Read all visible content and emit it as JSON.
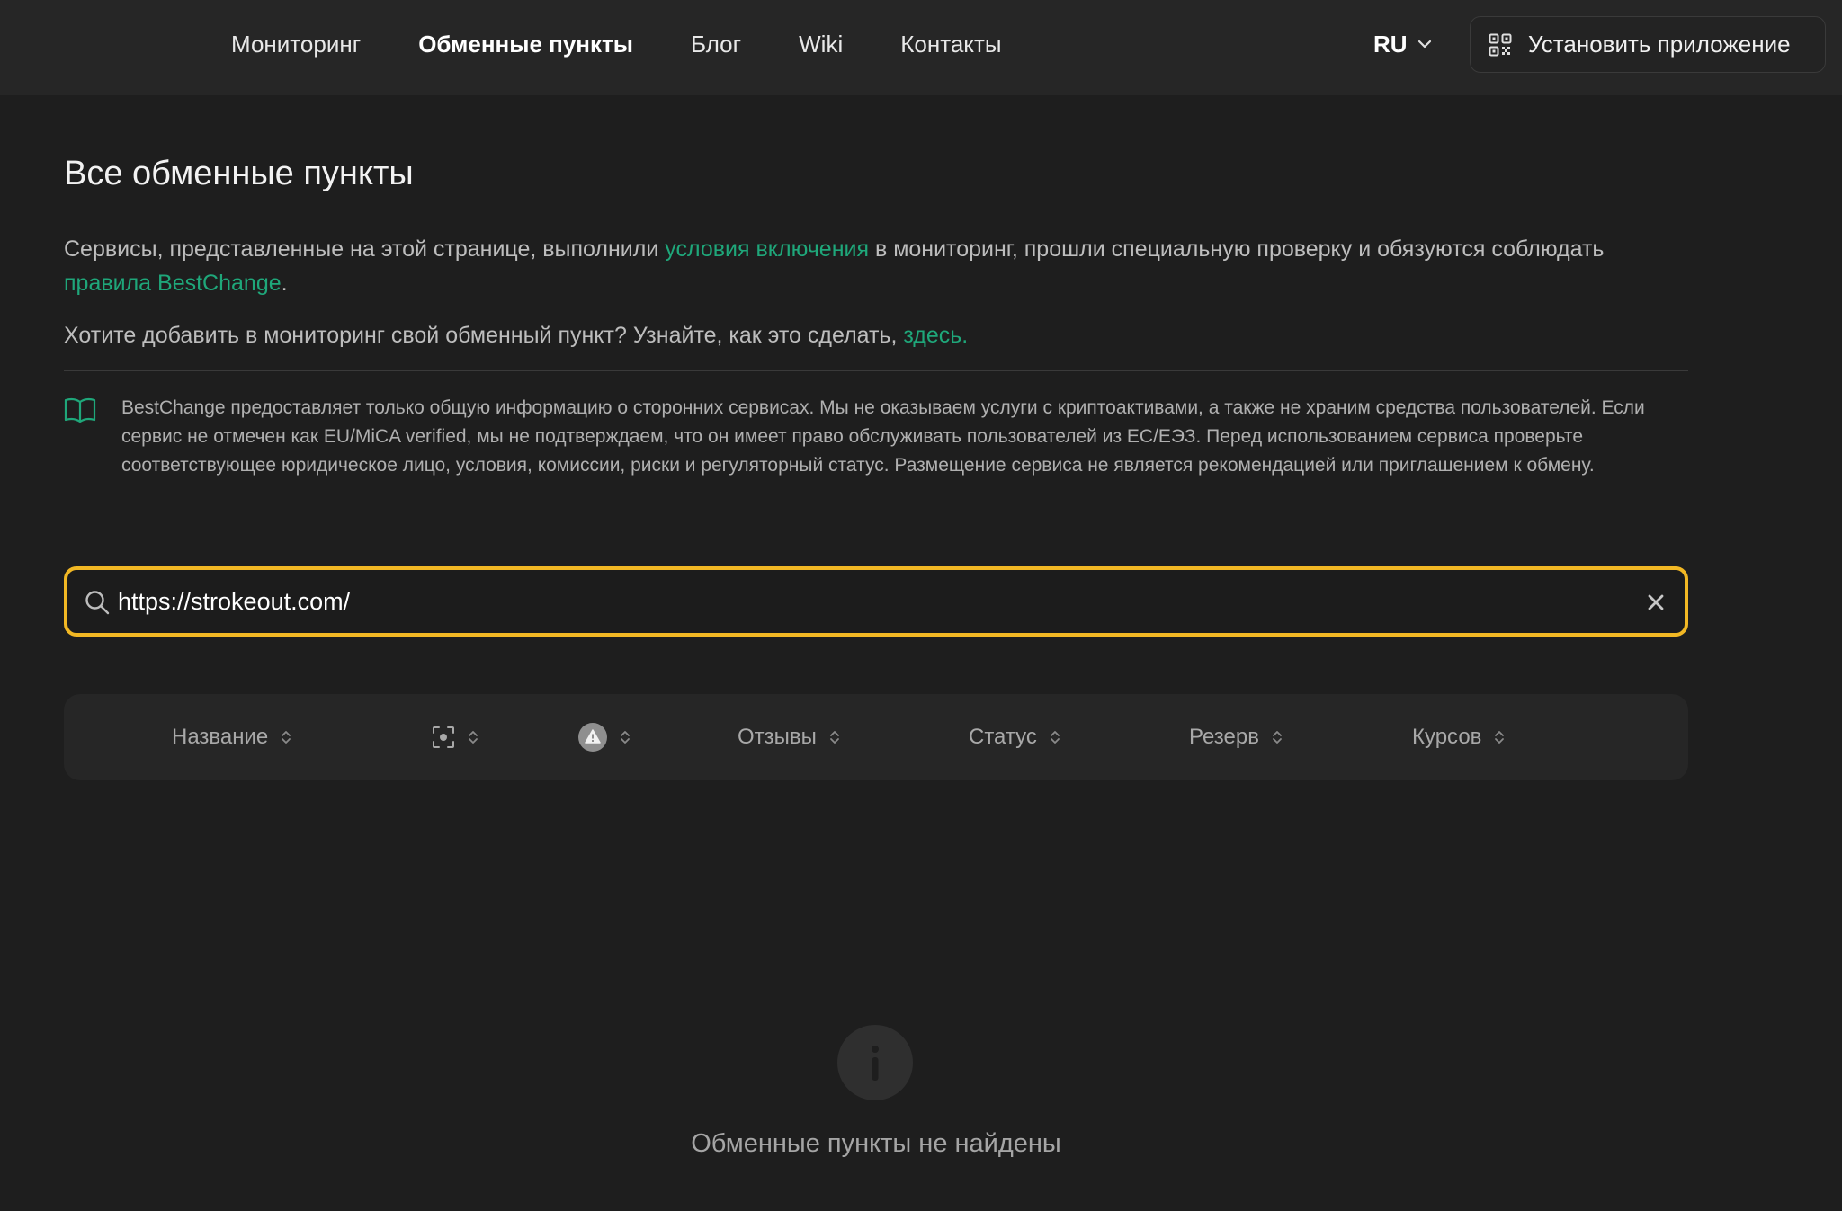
{
  "nav": {
    "items": [
      "Мониторинг",
      "Обменные пункты",
      "Блог",
      "Wiki",
      "Контакты"
    ],
    "active_index": 1
  },
  "header": {
    "language": "RU",
    "install_label": "Установить приложение"
  },
  "page": {
    "title": "Все обменные пункты",
    "intro_before": "Сервисы, представленные на этой странице, выполнили ",
    "intro_link1": "условия включения",
    "intro_middle": " в мониторинг, прошли специальную проверку и обязуются соблюдать ",
    "intro_link2": "правила BestChange",
    "intro_end": ".",
    "add_text": "Хотите добавить в мониторинг свой обменный пункт? Узнайте, как это сделать, ",
    "add_link": "здесь.",
    "notice": "BestChange предоставляет только общую информацию о сторонних сервисах. Мы не оказываем услуги с криптоактивами, а также не храним средства пользователей. Если сервис не отмечен как EU/MiCA verified, мы не подтверждаем, что он имеет право обслуживать пользователей из ЕС/ЕЭЗ. Перед использованием сервиса проверьте соответствующее юридическое лицо, условия, комиссии, риски и регуляторный статус. Размещение сервиса не является рекомендацией или приглашением к обмену."
  },
  "search": {
    "value": "https://strokeout.com/"
  },
  "table": {
    "columns": [
      "Название",
      "",
      "",
      "Отзывы",
      "Статус",
      "Резерв",
      "Курсов"
    ],
    "column_icons": [
      "",
      "verification-icon",
      "warning-icon",
      "",
      "",
      "",
      ""
    ]
  },
  "empty_state": {
    "text": "Обменные пункты не найдены"
  },
  "colors": {
    "accent": "#1fa77a",
    "search_border": "#f2b824",
    "background": "#1e1e1e",
    "header": "#262626"
  }
}
